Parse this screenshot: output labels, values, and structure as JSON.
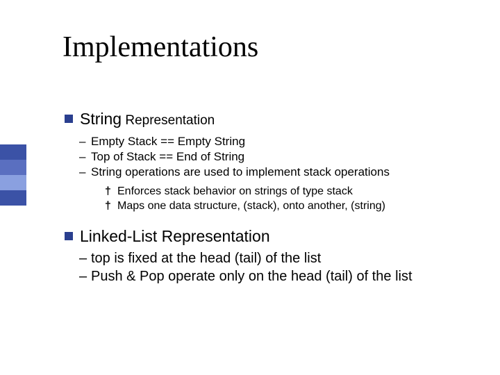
{
  "title": "Implementations",
  "sidebar_colors": [
    "#3b52a6",
    "#5a6fc0",
    "#8aa0e0",
    "#3b52a6"
  ],
  "sections": [
    {
      "head_main": "String",
      "head_sub": " Representation",
      "dashes": [
        "Empty Stack == Empty String",
        "Top of Stack == End of String",
        "String operations are used to implement stack operations"
      ],
      "daggers": [
        "Enforces stack behavior on strings of type stack",
        "Maps one data structure, (stack),  onto another, (string)"
      ]
    },
    {
      "head_main": "Linked-List Representation",
      "head_sub": "",
      "dashes": [
        "top is fixed at the head (tail) of the list",
        "Push & Pop operate only on the head (tail) of the list"
      ],
      "daggers": []
    }
  ]
}
